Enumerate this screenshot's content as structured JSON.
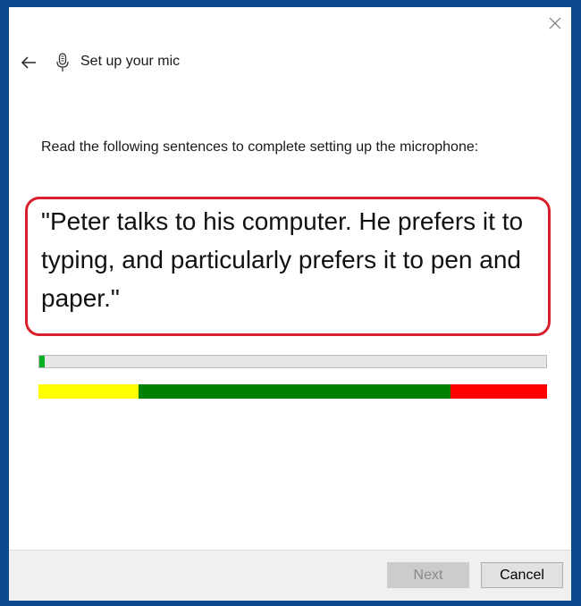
{
  "window": {
    "title": "Set up your mic",
    "close_icon": "close-icon",
    "back_icon": "back-arrow-icon",
    "mic_icon": "microphone-icon"
  },
  "main": {
    "instruction": "Read the following sentences to complete setting up the microphone:",
    "sentence": "\"Peter talks to his computer. He prefers it to typing, and particularly prefers it to pen and paper.\"",
    "highlight_color": "#d9202c"
  },
  "progress": {
    "fraction": 0.01,
    "color": "#06b025"
  },
  "level_meter": {
    "zones": [
      {
        "name": "low",
        "fraction": 0.196,
        "color": "#ffff00"
      },
      {
        "name": "good",
        "fraction": 0.614,
        "color": "#008000"
      },
      {
        "name": "high",
        "fraction": 0.19,
        "color": "#ff0000"
      }
    ]
  },
  "footer": {
    "next_label": "Next",
    "next_enabled": false,
    "cancel_label": "Cancel"
  }
}
